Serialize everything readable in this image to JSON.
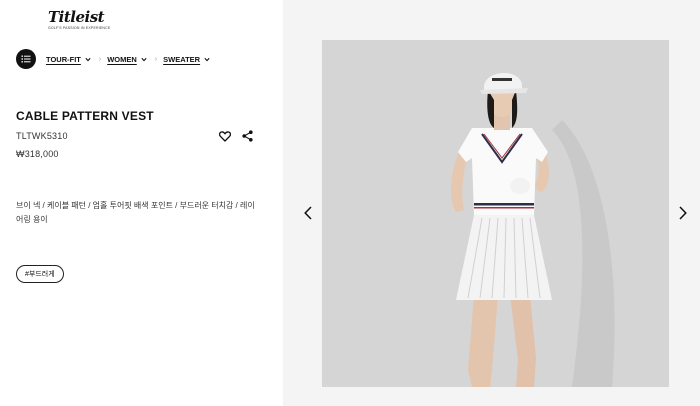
{
  "brand": {
    "logo_text": "Titleist",
    "tagline": "GOLF'S PASSION IN EXPERIENCE"
  },
  "breadcrumbs": [
    {
      "label": "TOUR-FIT"
    },
    {
      "label": "WOMEN"
    },
    {
      "label": "SWEATER"
    }
  ],
  "product": {
    "title": "CABLE PATTERN VEST",
    "sku": "TLTWK5310",
    "price": "₩318,000",
    "description": "브이 넥 / 케이블 패턴 / 엄홀 투어핏 배색 포인트 / 부드러운 터치감 / 레이어링 용이",
    "hashtag": "#부드러게"
  },
  "icons": {
    "menu": "list-icon",
    "wishlist": "heart-icon",
    "share": "share-icon",
    "prev": "chevron-left-icon",
    "next": "chevron-right-icon"
  },
  "colors": {
    "background": "#ffffff",
    "gallery_background": "#f4f4f4",
    "photo_background": "#d3d3d3",
    "text": "#111111"
  }
}
